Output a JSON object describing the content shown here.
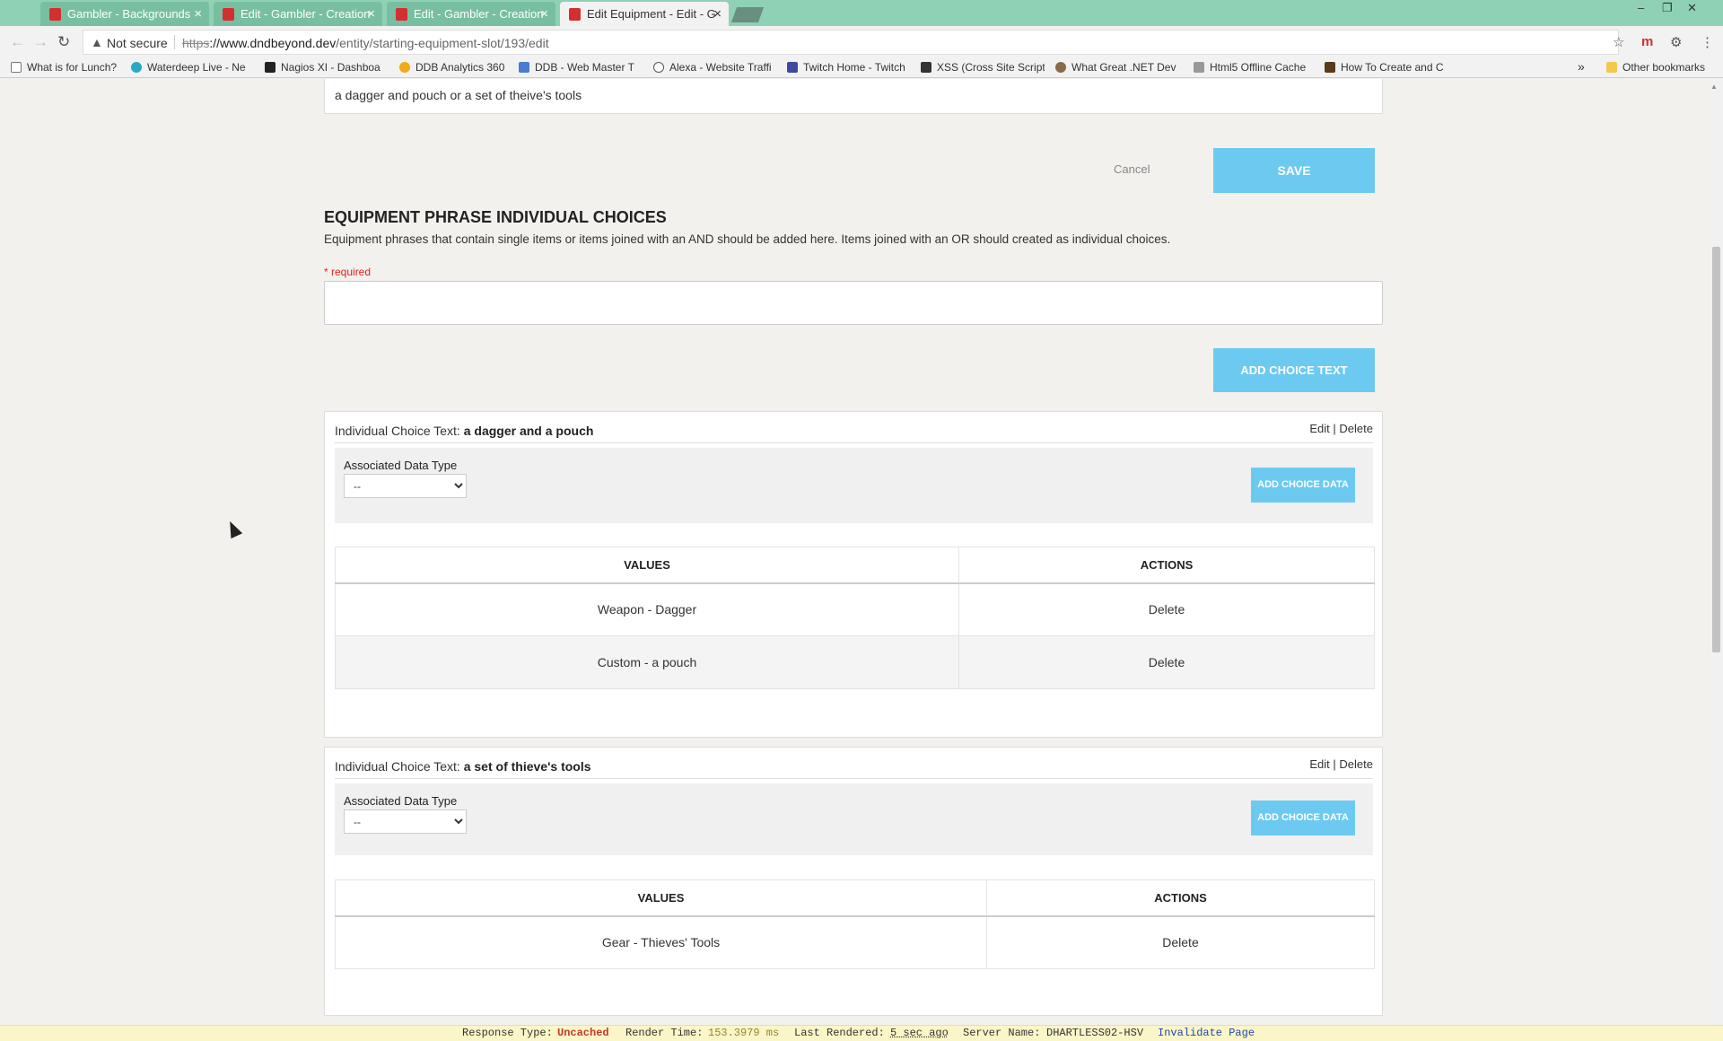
{
  "browser": {
    "tabs": [
      {
        "title": "Gambler - Backgrounds",
        "active": false
      },
      {
        "title": "Edit - Gambler - Creation",
        "active": false
      },
      {
        "title": "Edit - Gambler - Creation",
        "active": false
      },
      {
        "title": "Edit Equipment - Edit - G",
        "active": true
      }
    ],
    "security_label": "Not secure",
    "url_proto": "https",
    "url_host": "://www.dndbeyond.dev",
    "url_path": "/entity/starting-equipment-slot/193/edit",
    "bookmarks": [
      "What is for Lunch?",
      "Waterdeep Live - Ne",
      "Nagios XI - Dashboa",
      "DDB Analytics 360",
      "DDB - Web Master T",
      "Alexa - Website Traffi",
      "Twitch Home - Twitch",
      "XSS (Cross Site Script",
      "What Great .NET Dev",
      "Html5 Offline Cache",
      "How To Create and C"
    ],
    "bookmarks_overflow": "»",
    "other_bookmarks": "Other bookmarks"
  },
  "page": {
    "top_field_value": "a dagger and pouch or a set of theive's tools",
    "cancel_label": "Cancel",
    "save_label": "SAVE",
    "section_title": "EQUIPMENT PHRASE INDIVIDUAL CHOICES",
    "section_desc": "Equipment phrases that contain single items or items joined with an AND should be added here. Items joined with an OR should created as individual choices.",
    "required_label": "* required",
    "choice_input_value": "",
    "add_choice_text_label": "ADD CHOICE TEXT",
    "choices": [
      {
        "title_prefix": "Individual Choice Text: ",
        "title_value": "a dagger and a pouch",
        "edit": "Edit",
        "sep": "|",
        "delete": "Delete",
        "assoc_label": "Associated Data Type",
        "assoc_value": "--",
        "add_data_label": "ADD CHOICE DATA",
        "col_values": "VALUES",
        "col_actions": "ACTIONS",
        "rows": [
          {
            "value": "Weapon - Dagger",
            "action": "Delete"
          },
          {
            "value": "Custom - a pouch",
            "action": "Delete"
          }
        ]
      },
      {
        "title_prefix": "Individual Choice Text: ",
        "title_value": "a set of thieve's tools",
        "edit": "Edit",
        "sep": "|",
        "delete": "Delete",
        "assoc_label": "Associated Data Type",
        "assoc_value": "--",
        "add_data_label": "ADD CHOICE DATA",
        "col_values": "VALUES",
        "col_actions": "ACTIONS",
        "rows": [
          {
            "value": "Gear - Thieves' Tools",
            "action": "Delete"
          }
        ]
      }
    ]
  },
  "statusbar": {
    "response_label": "Response Type:",
    "response_value": "Uncached",
    "render_label": "Render Time:",
    "render_value": "153.3979 ms",
    "last_label": "Last Rendered:",
    "last_value": "5 sec ago",
    "server_label": "Server Name:",
    "server_value": "DHARTLESS02-HSV",
    "invalidate_label": "Invalidate Page"
  },
  "colors": {
    "accent_button": "#6ccaf0",
    "tabbar": "#8fd1b5",
    "required": "#e02020"
  }
}
